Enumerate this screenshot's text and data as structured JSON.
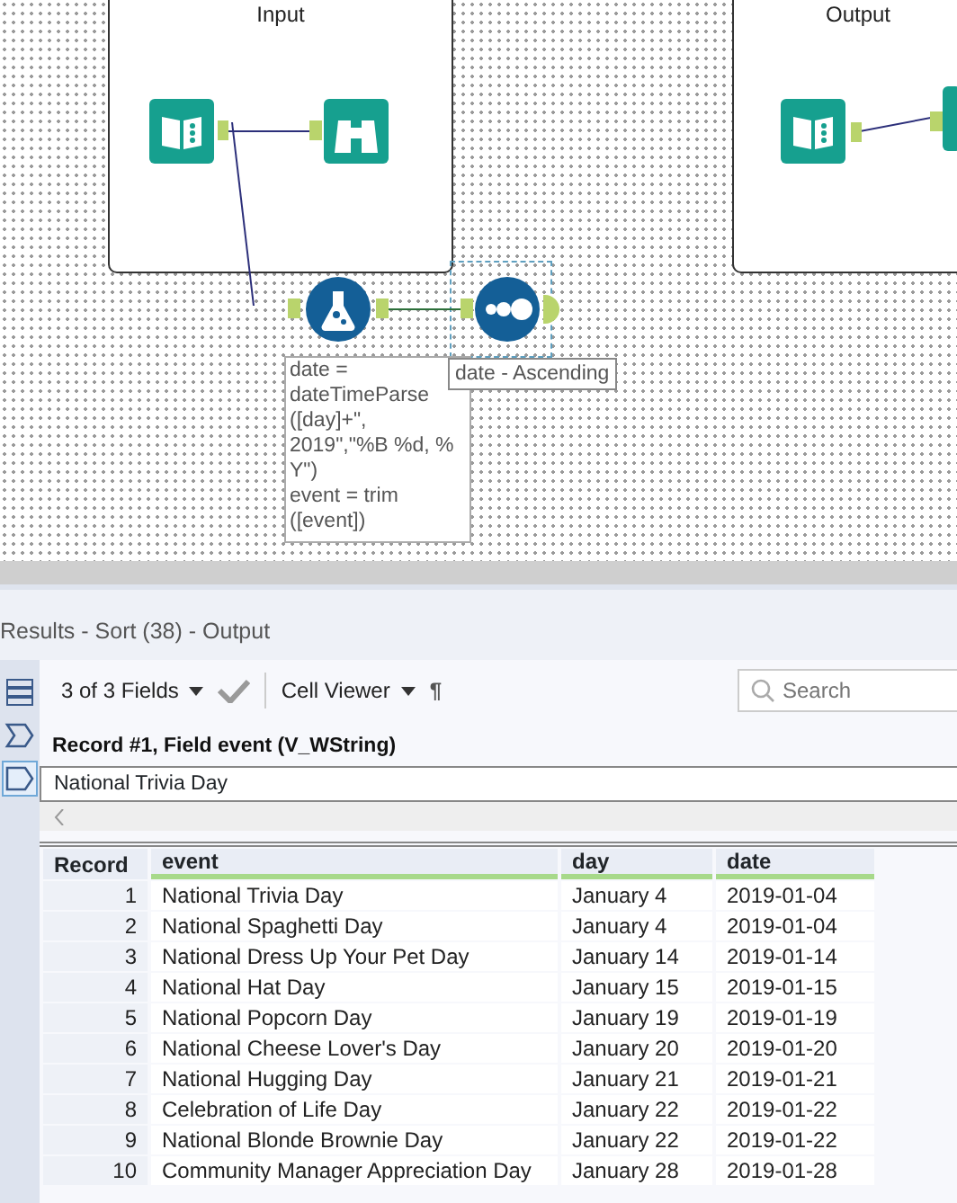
{
  "canvas": {
    "containers": [
      {
        "title": "Input"
      },
      {
        "title": "Output"
      }
    ],
    "formula_annotation": [
      "date =",
      "dateTimeParse",
      "([day]+\",",
      "2019\",\"%B %d, %",
      "Y\")",
      "event = trim",
      "([event])"
    ],
    "sort_annotation": "date - Ascending",
    "sort_tool_selected": true
  },
  "results": {
    "title": "Results - Sort (38) - Output",
    "side_tabs": [
      {
        "kind": "rows",
        "selected": false
      },
      {
        "kind": "chevron",
        "selected": false
      },
      {
        "kind": "tag",
        "selected": true
      }
    ],
    "toolbar": {
      "fields": "3 of 3 Fields",
      "viewer": "Cell Viewer",
      "pilcrow": "¶",
      "search": {
        "placeholder": "Search"
      }
    },
    "record_label": "Record #1, Field event (V_WString)",
    "cell_value": "National Trivia Day",
    "table": {
      "columns": [
        "Record",
        "event",
        "day",
        "date"
      ],
      "rows": [
        [
          "1",
          "National Trivia Day",
          "January 4",
          "2019-01-04"
        ],
        [
          "2",
          "National Spaghetti Day",
          "January 4",
          "2019-01-04"
        ],
        [
          "3",
          "National Dress Up Your Pet Day",
          "January 14",
          "2019-01-14"
        ],
        [
          "4",
          "National Hat Day",
          "January 15",
          "2019-01-15"
        ],
        [
          "5",
          "National Popcorn Day",
          "January 19",
          "2019-01-19"
        ],
        [
          "6",
          "National Cheese Lover's Day",
          "January 20",
          "2019-01-20"
        ],
        [
          "7",
          "National Hugging Day",
          "January 21",
          "2019-01-21"
        ],
        [
          "8",
          "Celebration of Life Day",
          "January 22",
          "2019-01-22"
        ],
        [
          "9",
          "National Blonde Brownie Day",
          "January 22",
          "2019-01-22"
        ],
        [
          "10",
          "Community Manager Appreciation Day",
          "January 28",
          "2019-01-28"
        ]
      ]
    }
  }
}
